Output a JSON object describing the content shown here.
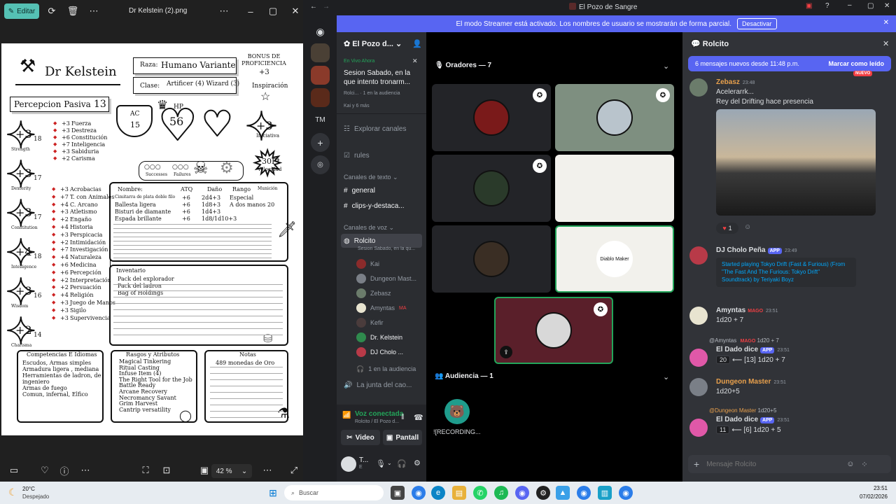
{
  "photos": {
    "edit_label": "Editar",
    "file_title": "Dr Kelstein (2).png",
    "zoom": "42 %",
    "sheet": {
      "name": "Dr Kelstein",
      "raza_label": "Raza:",
      "raza": "Humano Variante",
      "clase_label": "Clase:",
      "clase": "Artificer (4) Wizard (3)",
      "bonus_label": "BONUS DE PROFICIENCIA",
      "bonus": "+3",
      "inspiracion": "Inspiración",
      "percepcion_label": "Percepcion Pasiva",
      "percepcion": "13",
      "ac_label": "AC",
      "ac": "15",
      "hp_label": "HP",
      "hp": "56",
      "iniciativa_label": "Iniciativa",
      "iniciativa": "+3",
      "velocidad": "30Ft",
      "velocidad_label": "Velocidad",
      "successes": "Successes",
      "failures": "Failures",
      "stats": [
        {
          "mod": "+3",
          "score": "18",
          "label": "Strength"
        },
        {
          "mod": "+3",
          "score": "17",
          "label": "Dexterity"
        },
        {
          "mod": "+3",
          "score": "17",
          "label": "Constitution"
        },
        {
          "mod": "+4",
          "score": "18",
          "label": "Intelligence"
        },
        {
          "mod": "+3",
          "score": "16",
          "label": "Wisdom"
        },
        {
          "mod": "+2",
          "score": "14",
          "label": "Charisma"
        }
      ],
      "saves": [
        {
          "v": "+3",
          "n": "Fuerza"
        },
        {
          "v": "+3",
          "n": "Destreza"
        },
        {
          "v": "+6",
          "n": "Constitución"
        },
        {
          "v": "+7",
          "n": "Inteligencia"
        },
        {
          "v": "+3",
          "n": "Sabiduria"
        },
        {
          "v": "+2",
          "n": "Carisma"
        }
      ],
      "skills": [
        {
          "v": "+3",
          "n": "Acrobacias"
        },
        {
          "v": "+7",
          "n": "T. con Animales"
        },
        {
          "v": "+4",
          "n": "C. Arcano"
        },
        {
          "v": "+3",
          "n": "Atletismo"
        },
        {
          "v": "+2",
          "n": "Engaño"
        },
        {
          "v": "+4",
          "n": "Historia"
        },
        {
          "v": "+3",
          "n": "Perspicacia"
        },
        {
          "v": "+2",
          "n": "Intimidación"
        },
        {
          "v": "+7",
          "n": "Investigación"
        },
        {
          "v": "+4",
          "n": "Naturaleza"
        },
        {
          "v": "+6",
          "n": "Medicina"
        },
        {
          "v": "+6",
          "n": "Percepción"
        },
        {
          "v": "+2",
          "n": "Interpretación"
        },
        {
          "v": "+2",
          "n": "Persuación"
        },
        {
          "v": "+4",
          "n": "Religión"
        },
        {
          "v": "+3",
          "n": "Juego de Manos"
        },
        {
          "v": "+3",
          "n": "Sigilo"
        },
        {
          "v": "+3",
          "n": "Supervivencia"
        }
      ],
      "attack_headers": [
        "Nombre:",
        "ATQ",
        "Daño",
        "Rango",
        "Munición"
      ],
      "attacks": [
        {
          "name": "Cimitarra de plata doble filo",
          "atq": "+6",
          "dmg": "2d4+3",
          "range": "Especial",
          "ammo": ""
        },
        {
          "name": "Ballesta ligera",
          "atq": "+6",
          "dmg": "1d8+3",
          "range": "A dos manos",
          "ammo": "20"
        },
        {
          "name": "Bisturi de diamante",
          "atq": "+6",
          "dmg": "1d4+3",
          "range": "",
          "ammo": ""
        },
        {
          "name": "Espada brillante",
          "atq": "+6",
          "dmg": "1d8/1d10+3",
          "range": "",
          "ammo": ""
        }
      ],
      "inventory_label": "Inventario",
      "inventory": [
        "Pack del explorador",
        "Pack del ladron",
        "Bag of Holdings"
      ],
      "comp_label": "Competencias E Idiomas",
      "competencias": [
        "Escudos, Armas simples",
        "Armadura ligera , mediana",
        "Herramientas de ladron, de",
        "ingeniero",
        "Armas de fuego",
        "Comun, infernal, Elfico"
      ],
      "rasgos_label": "Rasgos y Atributos",
      "rasgos": [
        "Magical Tinkering",
        "Ritual Casting",
        "Infuse Item (4)",
        "The Right Tool for the Job",
        "Battle Ready",
        "Arcane Recovery",
        "Necromancy Savant",
        "Grim Harvest",
        "Cantrip versatility"
      ],
      "notas_label": "Notas",
      "notas": [
        "489 monedas de Oro"
      ]
    }
  },
  "discord": {
    "window_title": "El Pozo de Sangre",
    "streamer_text": "El modo Streamer está activado. Los nombres de usuario se mostrarán de forma parcial.",
    "streamer_button": "Desactivar",
    "server_name": "El Pozo d...",
    "guild_tm": "TM",
    "live": {
      "badge": "En Vivo Ahora",
      "title": "Sesion Sabado, en la que intento tronarm...",
      "host": "Rolci...",
      "audience": "1 en la audiencia",
      "sub": "Kai y 6 más"
    },
    "explore": "Explorar canales",
    "rules": "rules",
    "text_category": "Canales de texto",
    "text_channels": [
      "general",
      "clips-y-destaca..."
    ],
    "voice_category": "Canales de voz",
    "stage_channel": "Rolcito",
    "stage_sub": "Sesion Sabado, en la qu...",
    "voice_users": [
      {
        "name": "Kai",
        "color": "#8b2b2b",
        "tag": ""
      },
      {
        "name": "Dungeon Mast...",
        "color": "#7a7f87",
        "tag": ""
      },
      {
        "name": "Zebasz",
        "color": "#6b7c6b",
        "tag": ""
      },
      {
        "name": "Amyntas",
        "color": "#e8e4d0",
        "tag": "MA"
      },
      {
        "name": "Kefir",
        "color": "#4a3c3c",
        "tag": ""
      },
      {
        "name": "Dr. Kelstein",
        "color": "#2f8a4d",
        "tag": ""
      },
      {
        "name": "DJ Cholo ...",
        "color": "#b83a48",
        "tag": ""
      }
    ],
    "audience_line": "1 en la audiencia",
    "other_channel": "La junta del cao...",
    "voice_connected": "Voz conectada",
    "voice_location": "Rolcito / El Pozo d...",
    "video_btn": "Video",
    "screen_btn": "Pantall",
    "user_short": "T...",
    "user_status": "E",
    "speakers_header": "Oradores — 7",
    "audience_header": "Audiencia — 1",
    "audience_member": "![RECORDING...",
    "tiles": [
      {
        "bg": "#232428",
        "avatar": "#7a1a1a",
        "label": ""
      },
      {
        "bg": "#7e8f80",
        "avatar": "#b9c4cc",
        "label": ""
      },
      {
        "bg": "#232428",
        "avatar": "#2a3a2a",
        "label": ""
      },
      {
        "bg": "#f2f1ec",
        "avatar": "#f2f1ec",
        "label": ""
      },
      {
        "bg": "#232428",
        "avatar": "#3a2e24",
        "label": ""
      },
      {
        "bg": "#f2f1ec",
        "avatar": "#ffffff",
        "label": "Diablo Maker"
      },
      {
        "bg": "#5a1f2a",
        "avatar": "#d8d8d8",
        "label": ""
      }
    ],
    "chat": {
      "channel": "Rolcito",
      "banner": "6 mensajes nuevos desde 11:48 p.m.",
      "banner_action": "Marcar como leído",
      "new_tag": "NUEVO",
      "reaction_count": "1",
      "messages": [
        {
          "author": "Zebasz",
          "color": "#e8a04c",
          "time": "23:48",
          "lines": [
            "Acelerarrk...",
            "Rey del Drifting hace presencia"
          ]
        },
        {
          "author": "DJ Cholo Peña",
          "color": "#dbdee1",
          "app": "APP",
          "time": "23:49",
          "embed": "Started playing Tokyo Drift (Fast & Furious) (From \"The Fast And The Furious: Tokyo Drift\" Soundtrack) by Teriyaki Boyz"
        },
        {
          "author": "Amyntas",
          "color": "#dbdee1",
          "tag": "MAGO",
          "time": "23:51",
          "lines": [
            "1d20 + 7"
          ]
        },
        {
          "reply_author": "@Amyntas",
          "reply_tag": "MAGO",
          "reply_text": "1d20 + 7",
          "author": "El Dado dice",
          "color": "#dbdee1",
          "app": "APP",
          "time": "23:51",
          "result": "20",
          "detail": "⟵ [13] 1d20 + 7"
        },
        {
          "author": "Dungeon Master",
          "color": "#e8a04c",
          "time": "23:51",
          "lines": [
            "1d20+5"
          ]
        },
        {
          "reply_author": "@Dungeon Master",
          "reply_text": "1d20+5",
          "author": "El Dado dice",
          "color": "#dbdee1",
          "app": "APP",
          "time": "23:51",
          "result": "11",
          "detail": "⟵ [6] 1d20 + 5"
        }
      ],
      "input_placeholder": "Mensaje Rolcito"
    }
  },
  "taskbar": {
    "temp": "20°C",
    "weather": "Despejado",
    "search": "Buscar",
    "time": "23:51",
    "date": "07/02/2026"
  }
}
